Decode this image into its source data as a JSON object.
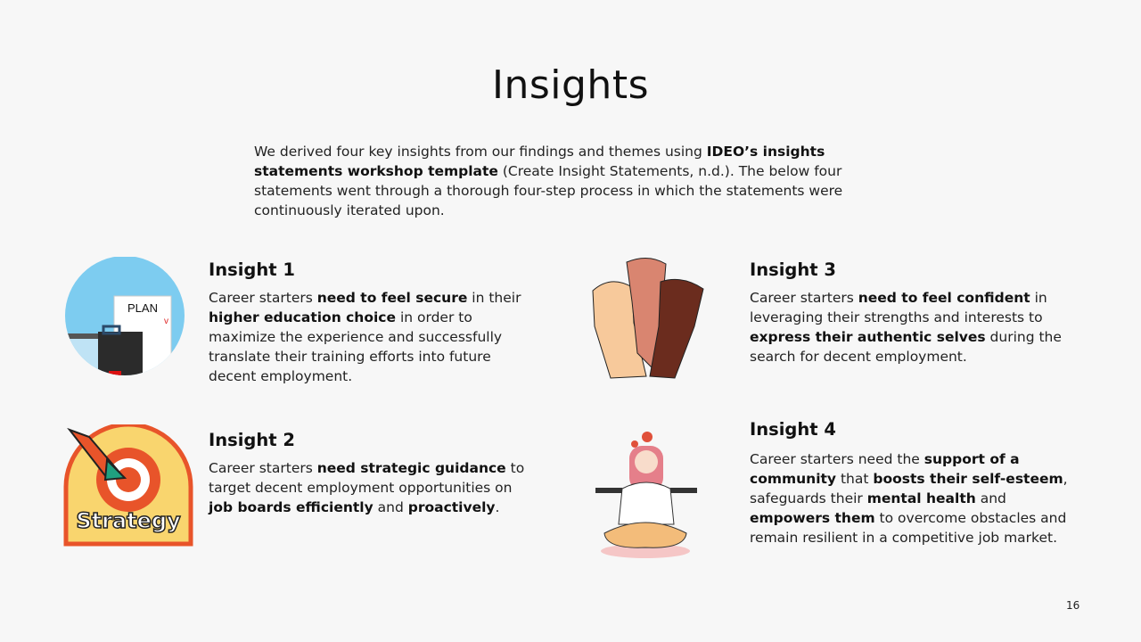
{
  "title": "Insights",
  "intro": [
    {
      "t": "We derived four key insights from our findings and themes using ",
      "b": false
    },
    {
      "t": "IDEO’s insights statements workshop template",
      "b": true
    },
    {
      "t": " (Create Insight Statements, n.d.). The below four statements went through a thorough four-step process in which the statements were continuously iterated upon.",
      "b": false
    }
  ],
  "insights": [
    {
      "heading": "Insight 1",
      "illustration": "plan-briefcase-calendar",
      "plan_label": "PLAN",
      "segments": [
        {
          "t": "Career starters ",
          "b": false
        },
        {
          "t": "need to feel secure",
          "b": true
        },
        {
          "t": " in their ",
          "b": false
        },
        {
          "t": "higher education choice",
          "b": true
        },
        {
          "t": " in order to maximize the experience and successfully translate their training efforts into future decent employment.",
          "b": false
        }
      ]
    },
    {
      "heading": "Insight 2",
      "illustration": "strategy-target-badge",
      "badge_label": "Strategy",
      "segments": [
        {
          "t": "Career starters ",
          "b": false
        },
        {
          "t": "need strategic guidance",
          "b": true
        },
        {
          "t": " to target decent employment opportunities on ",
          "b": false
        },
        {
          "t": "job boards efficiently",
          "b": true
        },
        {
          "t": " and ",
          "b": false
        },
        {
          "t": "proactively",
          "b": true
        },
        {
          "t": ".",
          "b": false
        }
      ]
    },
    {
      "heading": "Insight 3",
      "illustration": "raised-fists",
      "segments": [
        {
          "t": "Career starters ",
          "b": false
        },
        {
          "t": "need to feel confident",
          "b": true
        },
        {
          "t": " in leveraging their strengths and interests to ",
          "b": false
        },
        {
          "t": "express their authentic selves",
          "b": true
        },
        {
          "t": " during the search for decent employment.",
          "b": false
        }
      ]
    },
    {
      "heading": "Insight 4",
      "illustration": "meditating-woman-flowers",
      "segments": [
        {
          "t": "Career starters need the ",
          "b": false
        },
        {
          "t": "support of a community",
          "b": true
        },
        {
          "t": " that ",
          "b": false
        },
        {
          "t": "boosts their self-esteem",
          "b": true
        },
        {
          "t": ", safeguards their ",
          "b": false
        },
        {
          "t": "mental health",
          "b": true
        },
        {
          "t": " and ",
          "b": false
        },
        {
          "t": "empowers them",
          "b": true
        },
        {
          "t": " to overcome obstacles and remain resilient in a competitive job market.",
          "b": false
        }
      ]
    }
  ],
  "page_number": "16",
  "colors": {
    "background": "#f7f7f7",
    "text": "#111111",
    "circle_blue": "#7dccf0",
    "badge_yellow": "#f9d56e",
    "badge_orange": "#e8542a"
  }
}
